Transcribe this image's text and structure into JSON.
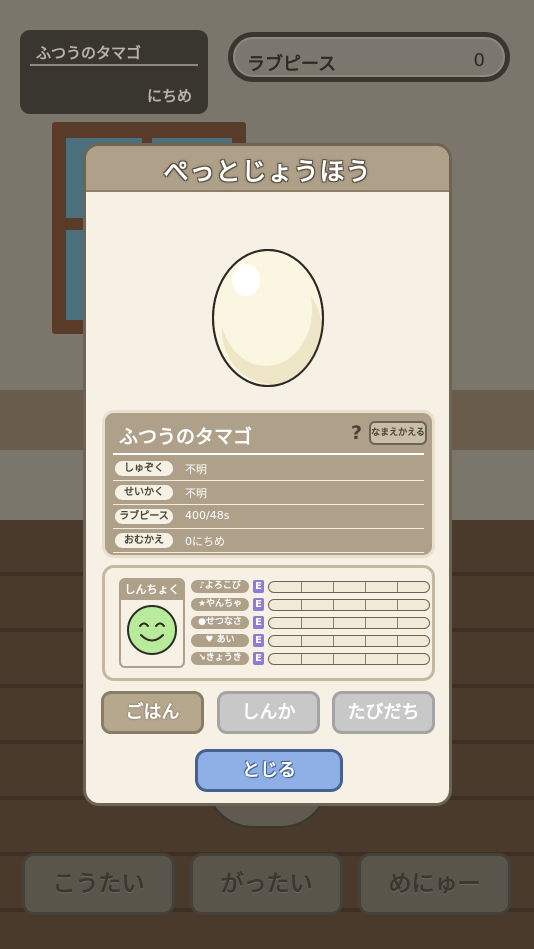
{
  "background": {
    "pet_name": "ふつうのタマゴ",
    "pet_age": "にちめ",
    "love_piece_label": "ラブピース",
    "love_piece_value": "0",
    "bottom_buttons": [
      "こうたい",
      "がったい",
      "めにゅー"
    ]
  },
  "modal": {
    "title": "ぺっとじょうほう",
    "info": {
      "name": "ふつうのタマゴ",
      "help": "?",
      "rename_label": "なまえかえる",
      "rows": [
        {
          "key": "しゅぞく",
          "value": "不明"
        },
        {
          "key": "せいかく",
          "value": "不明"
        },
        {
          "key": "ラブピース",
          "value": "400/48s"
        },
        {
          "key": "おむかえ",
          "value": "0にちめ"
        }
      ]
    },
    "mood": {
      "title": "しんちょく",
      "face_color": "#b8ec9a"
    },
    "stats": [
      {
        "label": "♪よろこび",
        "grade": "E",
        "level": 0
      },
      {
        "label": "★やんちゃ",
        "grade": "E",
        "level": 0
      },
      {
        "label": "●せつなさ",
        "grade": "E",
        "level": 0
      },
      {
        "label": "♥ あい",
        "grade": "E",
        "level": 0
      },
      {
        "label": "↘きょうき",
        "grade": "E",
        "level": 0
      }
    ],
    "actions": [
      {
        "label": "ごはん",
        "enabled": true
      },
      {
        "label": "しんか",
        "enabled": false
      },
      {
        "label": "たびだち",
        "enabled": false
      }
    ],
    "close_label": "とじる"
  },
  "colors": {
    "accent": "#aea089",
    "close_button": "#8fb0e6",
    "grade": "#8f7bd6"
  }
}
